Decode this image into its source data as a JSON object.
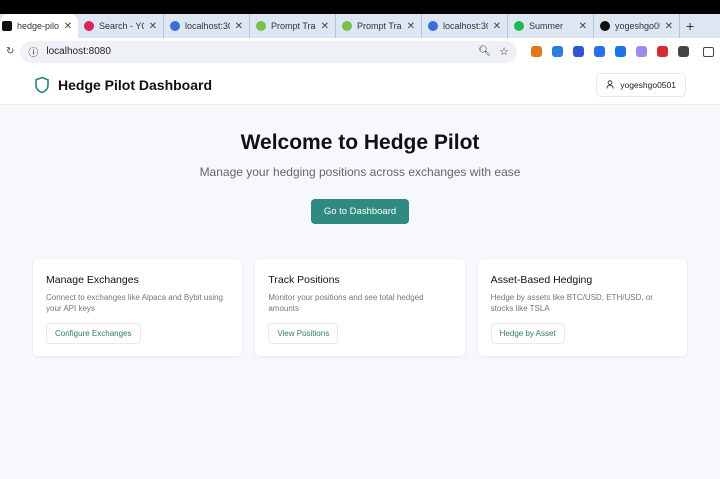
{
  "browser": {
    "tabs": [
      {
        "title": "hedge-pilot-",
        "active": true,
        "favicon": "shield-icon",
        "color": "#111"
      },
      {
        "title": "Search - YO",
        "favicon": "slack-icon",
        "color": "#e01e5a"
      },
      {
        "title": "localhost:30",
        "favicon": "globe-icon",
        "color": "#3b6fd8"
      },
      {
        "title": "Prompt Trad",
        "favicon": "chart-icon",
        "color": "#7bbf4a"
      },
      {
        "title": "Prompt Trad",
        "favicon": "chart-icon",
        "color": "#7bbf4a"
      },
      {
        "title": "localhost:30",
        "favicon": "globe-icon",
        "color": "#3b6fd8"
      },
      {
        "title": "Summer",
        "favicon": "spotify-icon",
        "color": "#1db954"
      },
      {
        "title": "yogeshgo05",
        "favicon": "github-icon",
        "color": "#111"
      }
    ],
    "new_tab": "+",
    "url": "localhost:8080",
    "extension_colors": [
      "#e2761b",
      "#2a7de1",
      "#3056d3",
      "#2b6ef0",
      "#1a73e8",
      "#9b8cf0",
      "#d32f2f",
      "#444"
    ]
  },
  "header": {
    "title": "Hedge Pilot Dashboard",
    "user": "yogeshgo0501",
    "accent": "#2f8a80"
  },
  "hero": {
    "title": "Welcome to Hedge Pilot",
    "subtitle": "Manage your hedging positions across exchanges with ease",
    "cta": "Go to Dashboard"
  },
  "cards": [
    {
      "title": "Manage Exchanges",
      "description": "Connect to exchanges like Alpaca and Bybit using your API keys",
      "button": "Configure Exchanges"
    },
    {
      "title": "Track Positions",
      "description": "Monitor your positions and see total hedged amounts",
      "button": "View Positions"
    },
    {
      "title": "Asset-Based Hedging",
      "description": "Hedge by assets like BTC/USD, ETH/USD, or stocks like TSLA",
      "button": "Hedge by Asset"
    }
  ]
}
